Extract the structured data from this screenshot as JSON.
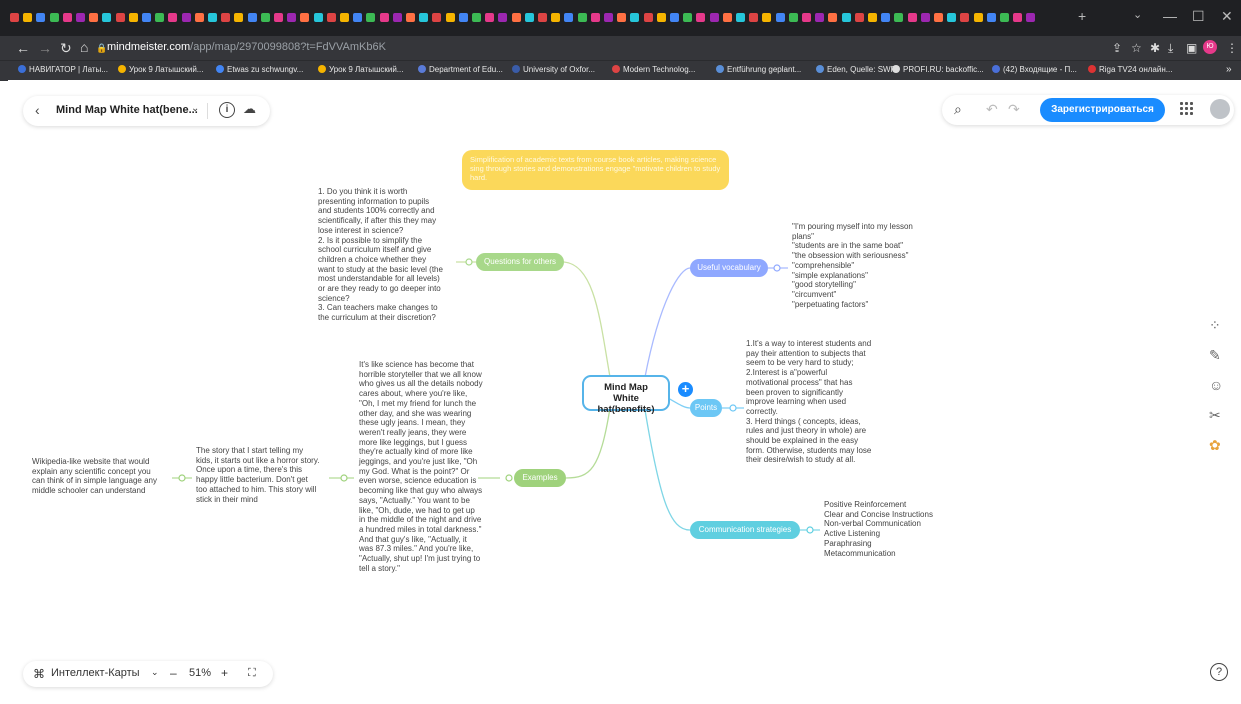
{
  "browser": {
    "url_host": "mindmeister.com",
    "url_path": "/app/map/2970099808?t=FdVVAmKb6K",
    "bookmarks": [
      "НАВИГАТОР | Латы...",
      "Урок 9 Латышский...",
      "Etwas zu schwungv...",
      "Урок 9 Латышский...",
      "Department of Edu...",
      "University of Oxfor...",
      "Modern Technolog...",
      "Entführung geplant...",
      "Eden, Quelle: SWR",
      "PROFI.RU: backoffic...",
      "(42) Входящие - П...",
      "Riga TV24 онлайн..."
    ],
    "bookmark_more": "»",
    "profile_initials": "Ю",
    "colors": {
      "tabstrip": "#1f2023",
      "toolbar": "#35363a"
    }
  },
  "app": {
    "map_title": "Mind Map White hat(bene...",
    "info_icon": "i",
    "signup_label": "Зарегистрироваться",
    "map_type_label": "Интеллект-Карты",
    "zoom_minus": "–",
    "zoom_value": "51%",
    "zoom_plus": "+",
    "help_label": "?",
    "accent": "#1a8cff"
  },
  "map": {
    "central": {
      "line1": "Mind Map",
      "line2": "White hat(benefits)"
    },
    "top_note": "Simplification of academic texts from course book articles, making science sing through stories and demonstrations engage \"motivate children to study hard.",
    "branches": {
      "questions": "Questions for others",
      "examples": "Examples",
      "vocabulary": "Useful vocabulary",
      "points": "Points",
      "communication": "Communication strategies"
    },
    "questions_text": [
      "1. Do you think it is worth",
      "presenting information to pupils",
      "and students 100% correctly and",
      "scientifically, if after this they may",
      "lose interest in science?",
      "2. Is it possible to simplify the",
      "school curriculum itself and give",
      "children a choice whether they",
      "want to study at the basic level (the",
      "most understandable for all levels)",
      "or are they ready to go deeper into",
      "science?",
      "3. Can teachers make changes to",
      "the curriculum at their discretion?"
    ],
    "examples_text": [
      "It's like science has become that",
      "horrible storyteller that we all know",
      "who gives us all the details nobody",
      "cares about, where you're like,",
      "\"Oh, I met my friend for lunch the",
      "other day, and she was wearing",
      "these ugly jeans. I mean, they",
      "weren't really jeans, they were",
      "more like leggings, but I guess",
      "they're actually kind of more like",
      "jeggings, and you're just like, \"Oh",
      "my God. What is the point?\" Or",
      "even worse, science education is",
      "becoming like that guy who always",
      "says, \"Actually.\" You want to be",
      "like, \"Oh, dude, we had to get up",
      "in the middle of the night and drive",
      "a hundred miles in total darkness.\"",
      "And that guy's like, \"Actually, it",
      "was 87.3 miles.\" And you're like,",
      "\"Actually, shut up! I'm just trying to",
      "tell a story.\""
    ],
    "story_text": [
      "The story that I start telling my",
      "kids, it starts out like a horror story.",
      "Once upon a time, there's this",
      "happy little bacterium. Don't get",
      "too attached to him. This story will",
      "stick in their mind"
    ],
    "wiki_text": [
      "Wikipedia-like website that would",
      "explain any scientific concept you",
      "can think of in simple language any",
      "middle schooler can understand"
    ],
    "vocabulary_text": [
      "\"I'm pouring myself into my lesson",
      "plans\"",
      "\"students are in the same boat\"",
      "\"the obsession with seriousness\"",
      "\"comprehensible\"",
      "\"simple explanations\"",
      "\"good storytelling\"",
      "\"circumvent\"",
      "\"perpetuating factors\""
    ],
    "points_text": [
      "1.It's a way to interest students and",
      " pay their attention to subjects that",
      "seem to be very hard to study;",
      "2.Interest is a\"powerful",
      "motivational process\" that has",
      "been proven to significantly",
      "improve learning when used",
      "correctly.",
      "3. Herd things ( concepts, ideas,",
      "rules and just theory in whole) are",
      "should be explained in the easy",
      "form. Otherwise, students may lose",
      "their desire/wish to study at all."
    ],
    "communication_text": [
      "Positive Reinforcement",
      "Clear and Concise Instructions",
      "Non-verbal Communication",
      "Active Listening",
      "Paraphrasing",
      "Metacommunication"
    ],
    "colors": {
      "questions": "#a8d88a",
      "examples": "#9fd27c",
      "vocabulary": "#8fa8ff",
      "points": "#6cc7f5",
      "communication": "#5fcfe0",
      "central_border": "#56b4e9",
      "top_note": "#fbd85a"
    }
  }
}
